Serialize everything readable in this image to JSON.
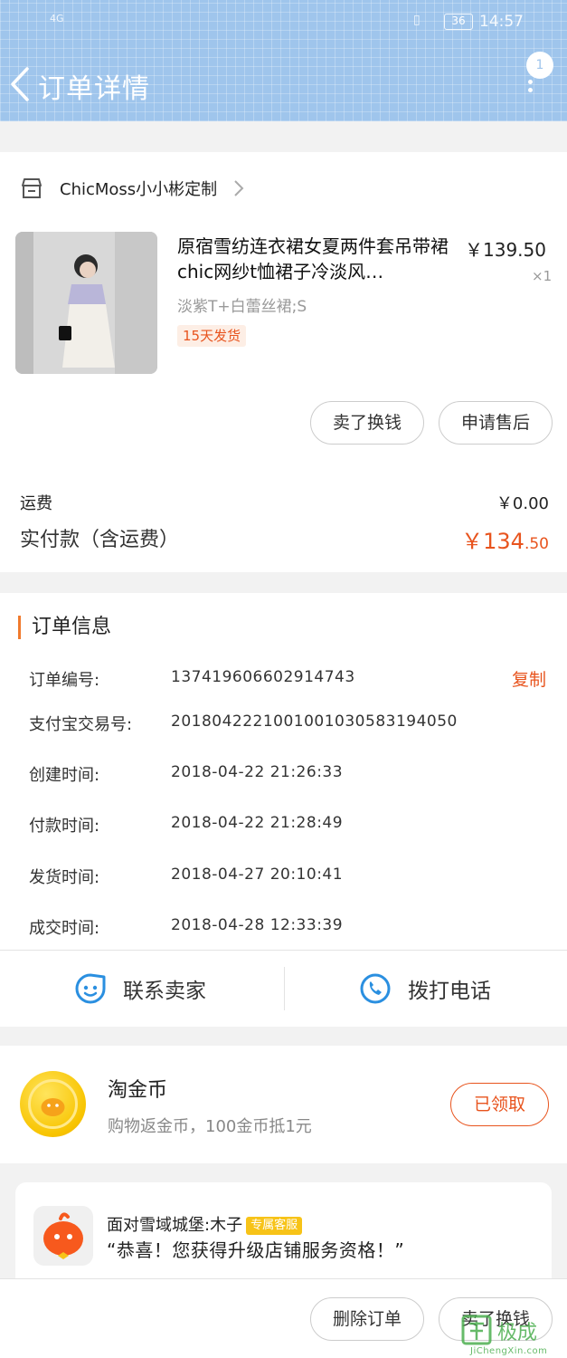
{
  "status_bar": {
    "signal": "4G",
    "battery": "36",
    "time": "14:57"
  },
  "header": {
    "title": "订单详情",
    "badge": "1"
  },
  "shop": {
    "name": "ChicMoss小小彬定制"
  },
  "product": {
    "title": "原宿雪纺连衣裙女夏两件套吊带裙chic网纱t恤裙子冷淡风…",
    "price": "￥139.50",
    "qty": "×1",
    "spec": "淡紫T+白蕾丝裙;S",
    "ship_tag": "15天发货"
  },
  "actions": {
    "sell_label": "卖了换钱",
    "aftersale_label": "申请售后"
  },
  "fees": {
    "shipping_label": "运费",
    "shipping_value": "￥0.00",
    "paid_label": "实付款（含运费）",
    "paid_main": "￥134",
    "paid_decimal": ".50"
  },
  "order_info": {
    "title": "订单信息",
    "copy_label": "复制",
    "rows": [
      {
        "label": "订单编号:",
        "value": "137419606602914743"
      },
      {
        "label": "支付宝交易号:",
        "value": "2018042221001001030583194050"
      },
      {
        "label": "创建时间:",
        "value": "2018-04-22 21:26:33"
      },
      {
        "label": "付款时间:",
        "value": "2018-04-22 21:28:49"
      },
      {
        "label": "发货时间:",
        "value": "2018-04-27 20:10:41"
      },
      {
        "label": "成交时间:",
        "value": "2018-04-28 12:33:39"
      }
    ]
  },
  "contact": {
    "seller_label": "联系卖家",
    "call_label": "拨打电话"
  },
  "coins": {
    "title": "淘金币",
    "desc": "购物返金币，100金币抵1元",
    "button_label": "已领取"
  },
  "service": {
    "name": "面对雪域城堡:木子",
    "tag": "专属客服",
    "message": "“恭喜！您获得升级店铺服务资格！”"
  },
  "bottom": {
    "delete_label": "删除订单",
    "sell_label": "卖了换钱"
  },
  "watermark": {
    "text": "极成",
    "sub": "JiChengXin.com"
  },
  "colors": {
    "accent": "#e8541e",
    "header": "#9fc5ec",
    "icon_blue": "#2a8fe0"
  }
}
